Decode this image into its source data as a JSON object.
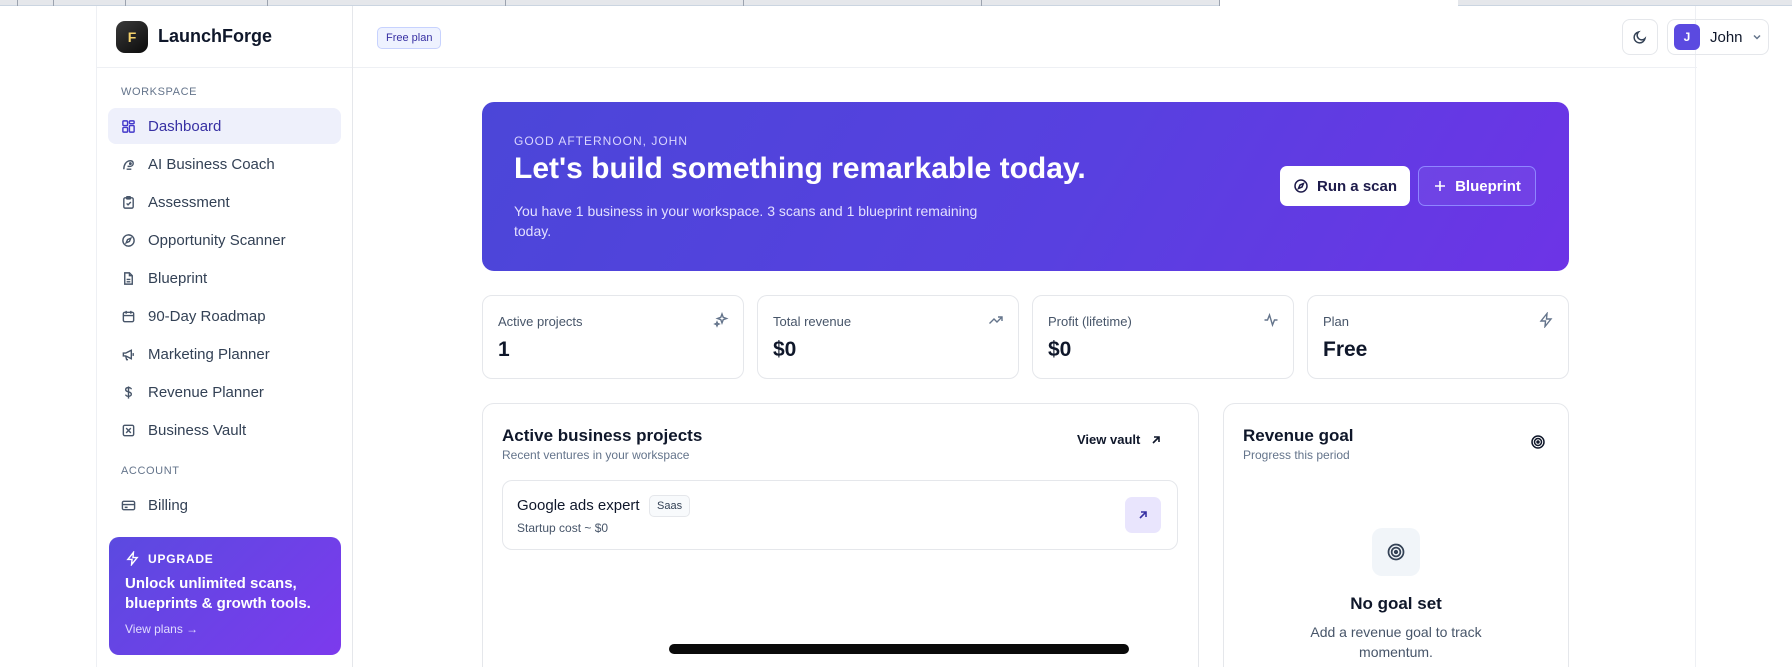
{
  "brand": {
    "name": "LaunchForge",
    "logo_letter": "F"
  },
  "sidebar": {
    "workspace_label": "WORKSPACE",
    "account_label": "ACCOUNT",
    "items": [
      {
        "label": "Dashboard",
        "icon": "grid-icon",
        "active": true
      },
      {
        "label": "AI Business Coach",
        "icon": "coach-icon"
      },
      {
        "label": "Assessment",
        "icon": "clipboard-icon"
      },
      {
        "label": "Opportunity Scanner",
        "icon": "compass-icon"
      },
      {
        "label": "Blueprint",
        "icon": "document-icon"
      },
      {
        "label": "90-Day Roadmap",
        "icon": "calendar-icon"
      },
      {
        "label": "Marketing Planner",
        "icon": "megaphone-icon"
      },
      {
        "label": "Revenue Planner",
        "icon": "dollar-icon"
      },
      {
        "label": "Business Vault",
        "icon": "vault-icon"
      }
    ],
    "account_items": [
      {
        "label": "Billing",
        "icon": "credit-card-icon"
      }
    ],
    "upgrade": {
      "heading": "UPGRADE",
      "text": "Unlock unlimited scans, blueprints & growth tools.",
      "link": "View plans →"
    }
  },
  "header": {
    "plan_badge": "Free plan",
    "user": {
      "initial": "J",
      "name": "John"
    }
  },
  "hero": {
    "eyebrow": "GOOD AFTERNOON, JOHN",
    "title": "Let's build something remarkable today.",
    "subtitle": "You have 1 business in your workspace. 3 scans and 1 blueprint remaining today.",
    "primary_button": "Run a scan",
    "secondary_button": "Blueprint"
  },
  "stats": [
    {
      "label": "Active projects",
      "value": "1",
      "icon": "sparkles-icon"
    },
    {
      "label": "Total revenue",
      "value": "$0",
      "icon": "trending-up-icon"
    },
    {
      "label": "Profit (lifetime)",
      "value": "$0",
      "icon": "activity-icon"
    },
    {
      "label": "Plan",
      "value": "Free",
      "icon": "zap-icon"
    }
  ],
  "projects_panel": {
    "title": "Active business projects",
    "subtitle": "Recent ventures in your workspace",
    "view_vault": "View vault",
    "project": {
      "name": "Google ads expert",
      "tag": "Saas",
      "cost": "Startup cost ~ $0"
    }
  },
  "goal_panel": {
    "title": "Revenue goal",
    "subtitle": "Progress this period",
    "empty_title": "No goal set",
    "empty_subtitle": "Add a revenue goal to track momentum."
  },
  "colors": {
    "accent": "#5b4ae0",
    "accent_end": "#6d34e6",
    "active_nav_bg": "#eef0fb"
  }
}
